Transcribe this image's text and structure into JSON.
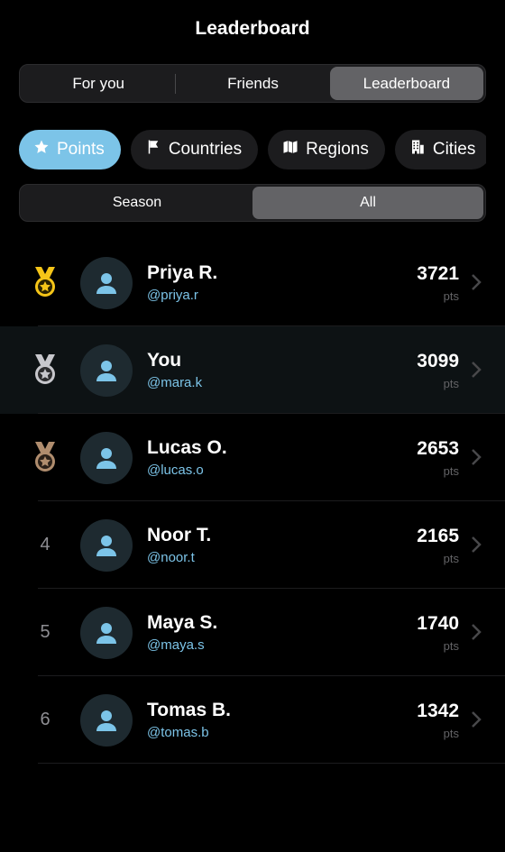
{
  "header": {
    "title": "Leaderboard"
  },
  "top_tabs": [
    {
      "label": "For you",
      "active": false
    },
    {
      "label": "Friends",
      "active": false
    },
    {
      "label": "Leaderboard",
      "active": true
    }
  ],
  "chips": [
    {
      "label": "Points",
      "icon": "star-icon",
      "active": true
    },
    {
      "label": "Countries",
      "icon": "flag-icon",
      "active": false
    },
    {
      "label": "Regions",
      "icon": "map-icon",
      "active": false
    },
    {
      "label": "Cities",
      "icon": "building-icon",
      "active": false
    }
  ],
  "scope_tabs": [
    {
      "label": "Season",
      "active": false
    },
    {
      "label": "All",
      "active": true
    }
  ],
  "entries": [
    {
      "rank": "1",
      "medal": "gold",
      "name": "Priya R.",
      "handle": "@priya.r",
      "points": "3721",
      "unit": "pts"
    },
    {
      "rank": "2",
      "medal": "silver",
      "name": "You",
      "handle": "@mara.k",
      "points": "3099",
      "unit": "pts",
      "is_me": true
    },
    {
      "rank": "3",
      "medal": "bronze",
      "name": "Lucas O.",
      "handle": "@lucas.o",
      "points": "2653",
      "unit": "pts"
    },
    {
      "rank": "4",
      "name": "Noor T.",
      "handle": "@noor.t",
      "points": "2165",
      "unit": "pts"
    },
    {
      "rank": "5",
      "name": "Maya S.",
      "handle": "@maya.s",
      "points": "1740",
      "unit": "pts"
    },
    {
      "rank": "6",
      "name": "Tomas B.",
      "handle": "@tomas.b",
      "points": "1342",
      "unit": "pts"
    }
  ],
  "colors": {
    "accent": "#7cc4e8",
    "gold": "#f5c518",
    "silver": "#c7c7cc",
    "bronze": "#b08d6e"
  }
}
